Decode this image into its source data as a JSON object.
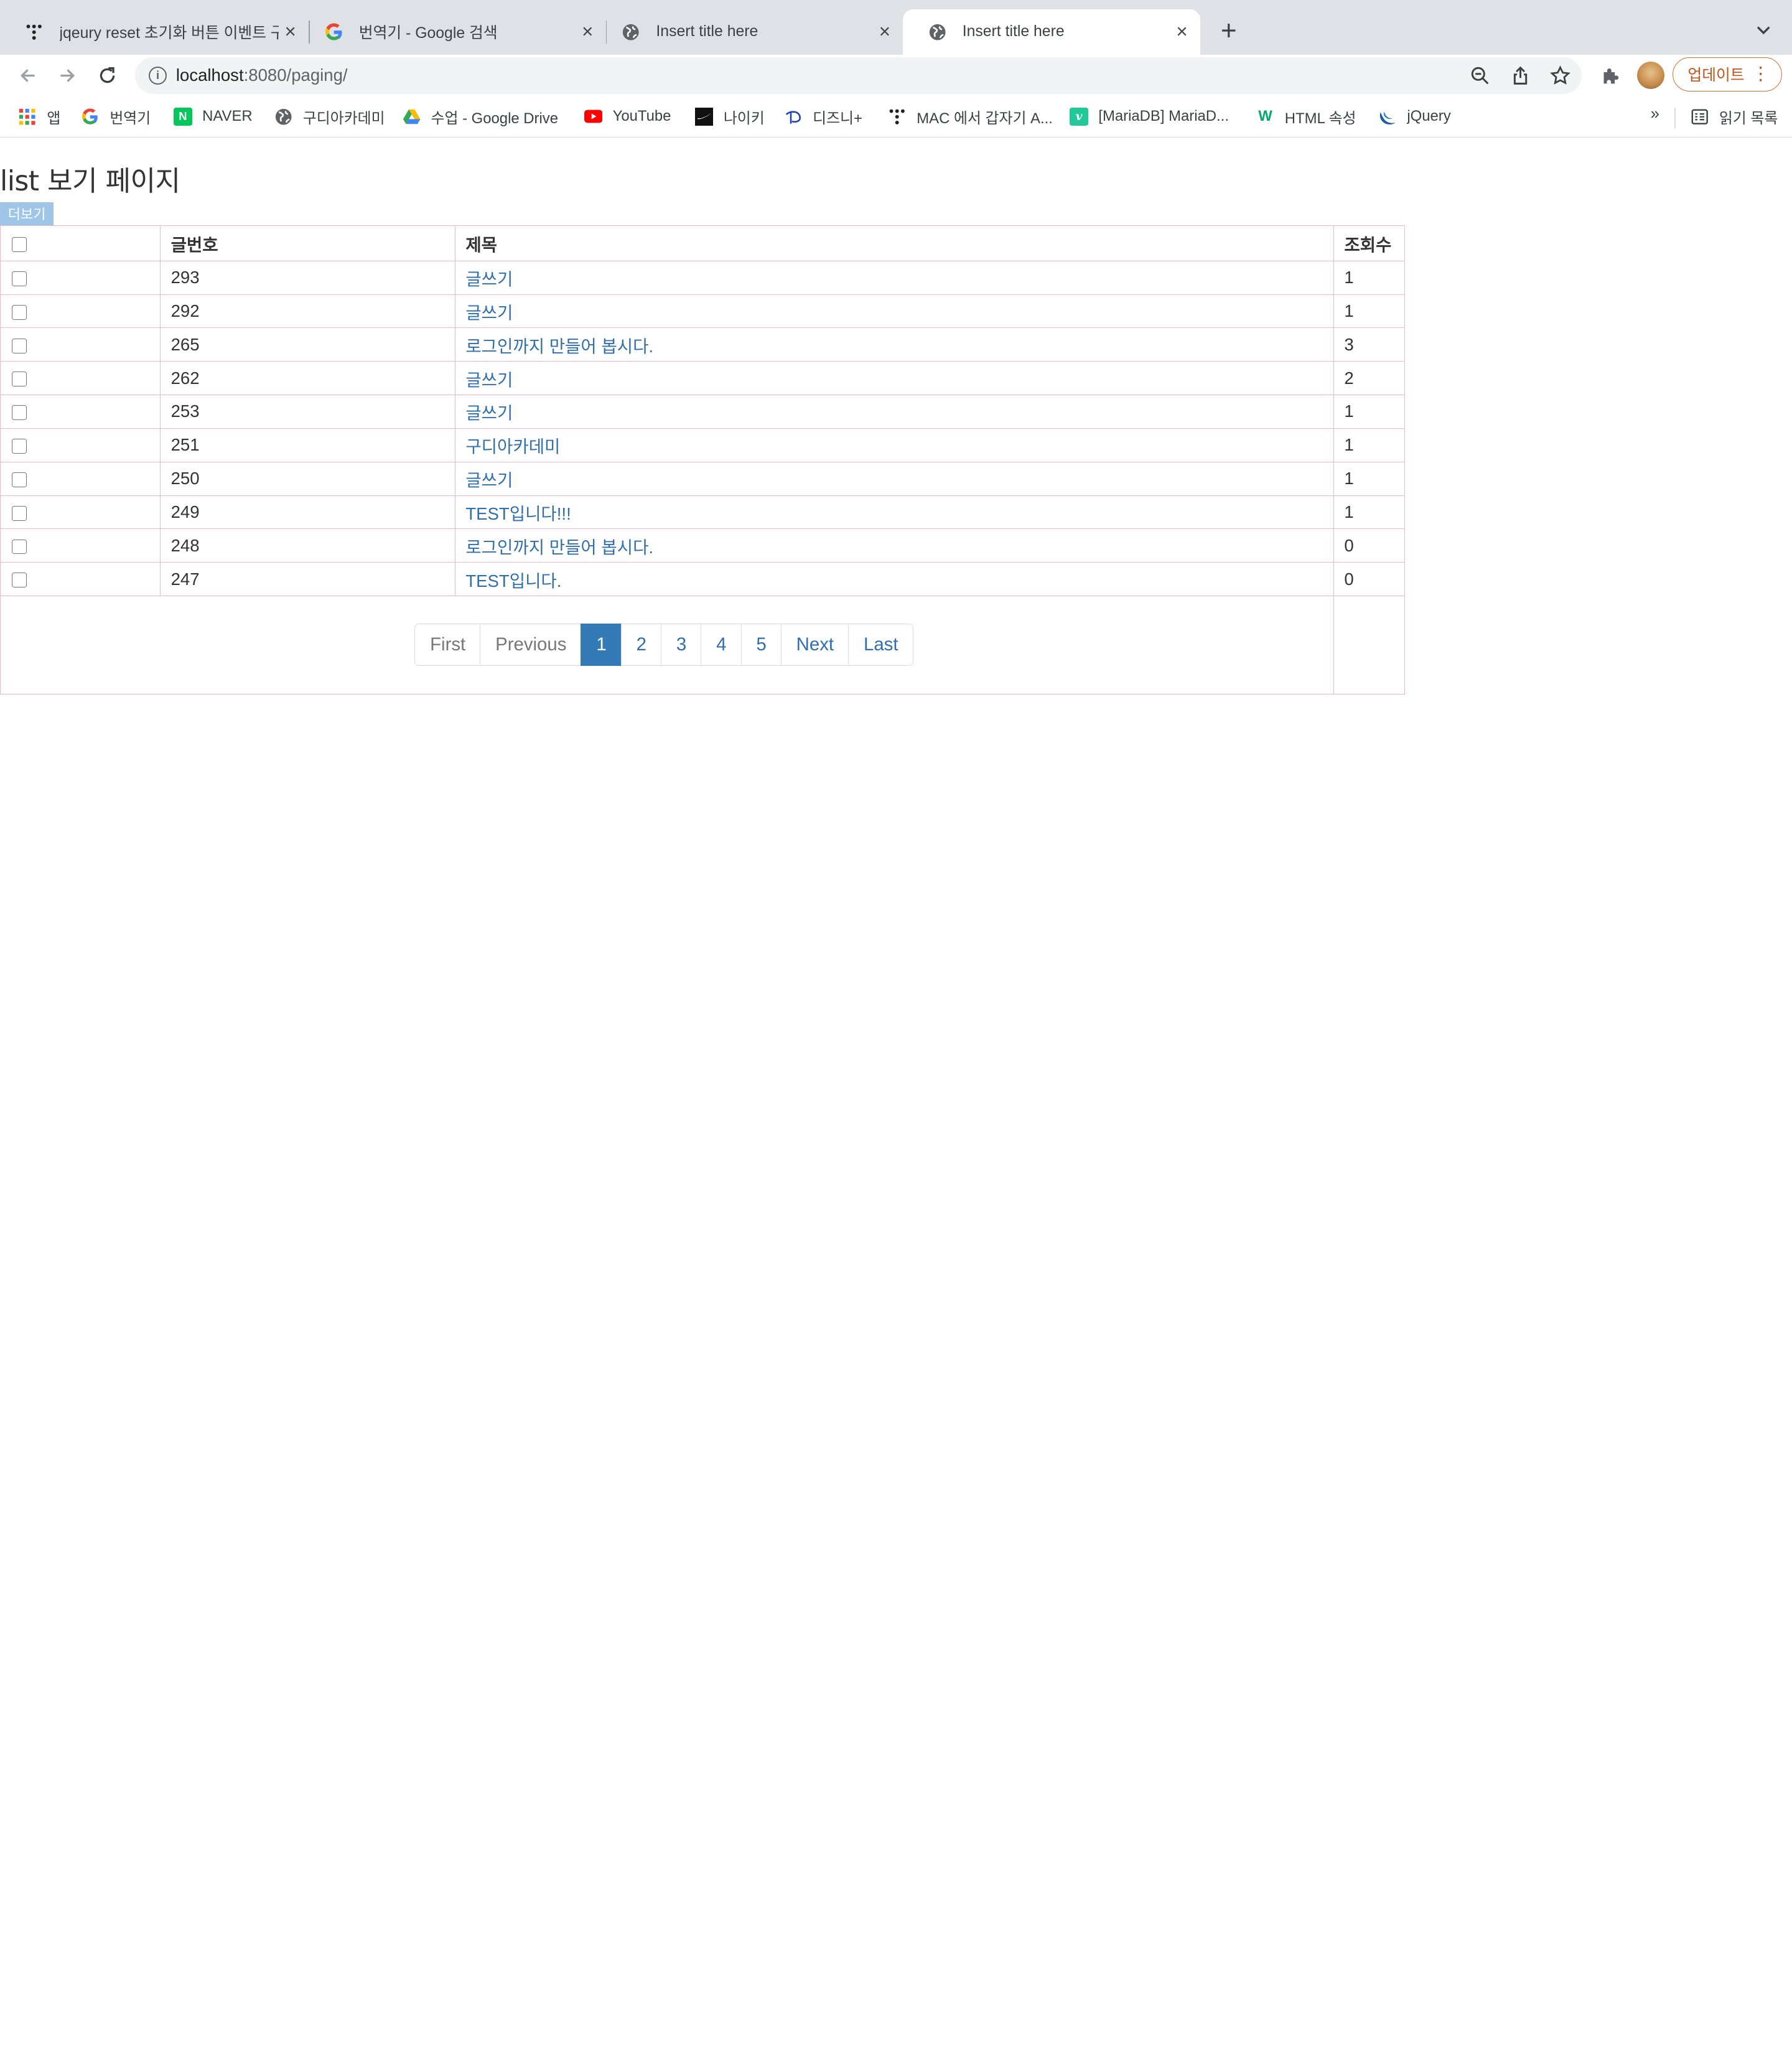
{
  "browser": {
    "tabs": [
      {
        "title": "jqeury reset 초기화 버튼 이벤트 구",
        "favicon": "tistory-dots-icon",
        "active": false
      },
      {
        "title": "번역기 - Google 검색",
        "favicon": "google-g-icon",
        "active": false
      },
      {
        "title": "Insert title here",
        "favicon": "globe-icon",
        "active": false
      },
      {
        "title": "Insert title here",
        "favicon": "globe-icon",
        "active": true
      }
    ],
    "url": {
      "host": "localhost",
      "rest": ":8080/paging/"
    },
    "update_label": "업데이트",
    "bookmarks": [
      {
        "label": "앱",
        "icon": "apps-grid-icon"
      },
      {
        "label": "번역기",
        "icon": "google-g-icon"
      },
      {
        "label": "NAVER",
        "icon": "naver-icon"
      },
      {
        "label": "구디아카데미",
        "icon": "globe-icon"
      },
      {
        "label": "수업 - Google Drive",
        "icon": "google-drive-icon"
      },
      {
        "label": "YouTube",
        "icon": "youtube-icon"
      },
      {
        "label": "나이키",
        "icon": "nike-icon"
      },
      {
        "label": "디즈니+",
        "icon": "disney-plus-icon"
      },
      {
        "label": "MAC 에서 갑자기 A...",
        "icon": "tistory-dots-icon"
      },
      {
        "label": "[MariaDB] MariaD...",
        "icon": "velog-icon"
      },
      {
        "label": "HTML 속성",
        "icon": "w3schools-icon"
      },
      {
        "label": "jQuery",
        "icon": "jquery-icon"
      }
    ],
    "reading_list_label": "읽기 목록",
    "more_bookmarks": "»"
  },
  "page": {
    "title": "list 보기 페이지",
    "more_button": "더보기",
    "table": {
      "headers": [
        "",
        "글번호",
        "제목",
        "조회수"
      ],
      "rows": [
        {
          "no": "293",
          "subject": "글쓰기",
          "views": "1"
        },
        {
          "no": "292",
          "subject": "글쓰기",
          "views": "1"
        },
        {
          "no": "265",
          "subject": "로그인까지 만들어 봅시다.",
          "views": "3"
        },
        {
          "no": "262",
          "subject": "글쓰기",
          "views": "2"
        },
        {
          "no": "253",
          "subject": "글쓰기",
          "views": "1"
        },
        {
          "no": "251",
          "subject": "구디아카데미",
          "views": "1"
        },
        {
          "no": "250",
          "subject": "글쓰기",
          "views": "1"
        },
        {
          "no": "249",
          "subject": "TEST입니다!!!",
          "views": "1"
        },
        {
          "no": "248",
          "subject": "로그인까지 만들어 봅시다.",
          "views": "0"
        },
        {
          "no": "247",
          "subject": "TEST입니다.",
          "views": "0"
        }
      ]
    },
    "pagination": {
      "first": "First",
      "previous": "Previous",
      "pages": [
        "1",
        "2",
        "3",
        "4",
        "5"
      ],
      "current": "1",
      "next": "Next",
      "last": "Last"
    }
  },
  "colors": {
    "link": "#2f6fb0",
    "table_border": "#f2b8c6",
    "active_page": "#337ab7",
    "more_button": "#9fc6e6",
    "update_button": "#c5551a"
  }
}
